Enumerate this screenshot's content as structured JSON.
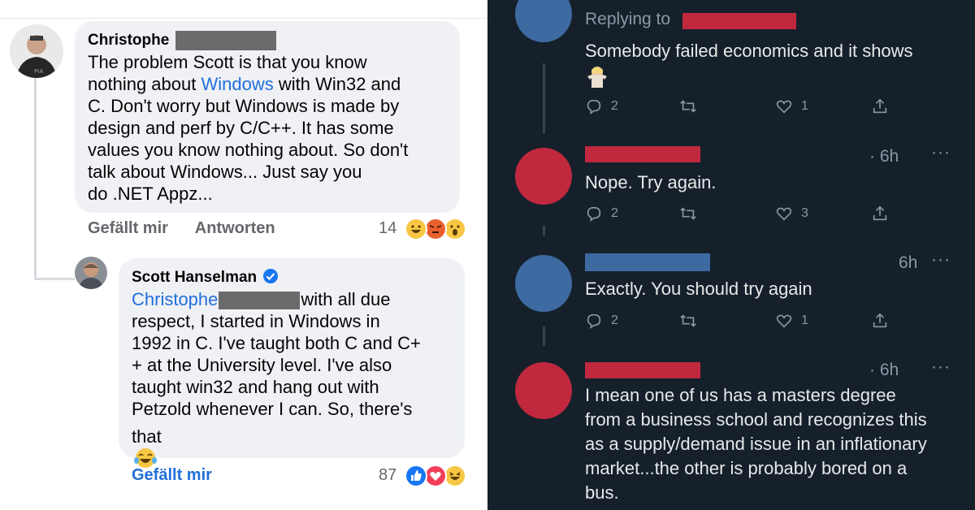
{
  "facebook": {
    "comment1": {
      "author": "Christophe",
      "text_before_link": "The problem Scott is that you know\nnothing about ",
      "link": "Windows",
      "text_after_link": " with Win32 and\nC. Don't worry but Windows is made by\ndesign and perf by C/C++. It has some\nvalues you know nothing about. So don't\ntalk about Windows... Just say you\ndo .NET Appz...",
      "like_label": "Gefällt mir",
      "reply_label": "Antworten",
      "reaction_count": "14"
    },
    "comment2": {
      "author": "Scott Hanselman",
      "mention": "Christophe",
      "text_line1_after": "with all due",
      "text_rest": "respect, I started in Windows in\n1992 in C. I've taught both C and C+\n+ at the University level. I've also\ntaught win32 and hang out with\nPetzold whenever I can. So, there's",
      "text_last": "that",
      "like_label": "Gefällt mir",
      "reaction_count": "87"
    }
  },
  "twitter": {
    "tweet1": {
      "replying_label": "Replying to",
      "text": "Somebody failed economics and it shows",
      "replies": "2",
      "likes": "1"
    },
    "tweet2": {
      "time": "· 6h",
      "text": "Nope. Try again.",
      "replies": "2",
      "likes": "3"
    },
    "tweet3": {
      "time": "6h",
      "text": "Exactly.  You should try again",
      "replies": "2",
      "likes": "1"
    },
    "tweet4": {
      "time": "· 6h",
      "text_lines": [
        "I mean one of us has a masters degree",
        "from a business school and recognizes this",
        "as a supply/demand issue in an inflationary",
        "market...the other is probably bored on a",
        "bus."
      ]
    },
    "more_icon": "···",
    "colors": {
      "red_avatar": "#c0283e",
      "blue_avatar": "#3d6aa0",
      "background": "#15202b"
    }
  }
}
